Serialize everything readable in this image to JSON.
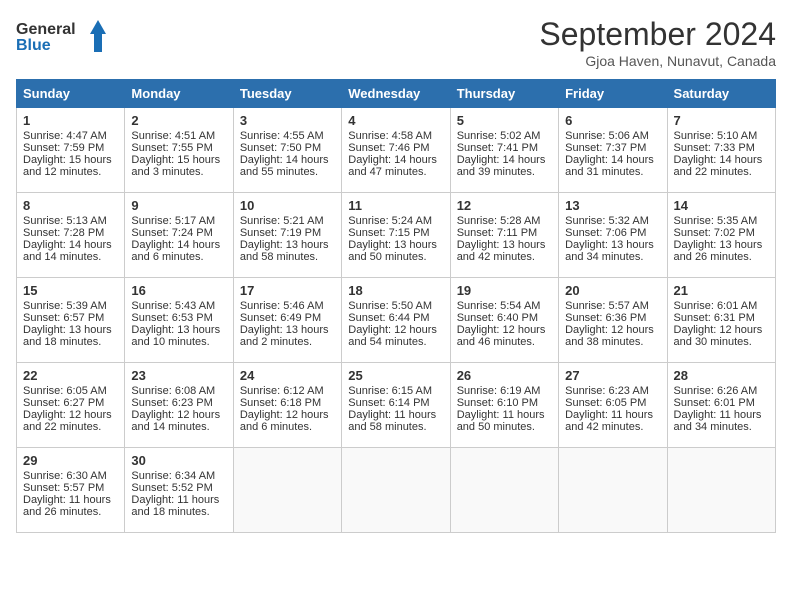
{
  "header": {
    "logo_line1": "General",
    "logo_line2": "Blue",
    "month_title": "September 2024",
    "location": "Gjoa Haven, Nunavut, Canada"
  },
  "days_of_week": [
    "Sunday",
    "Monday",
    "Tuesday",
    "Wednesday",
    "Thursday",
    "Friday",
    "Saturday"
  ],
  "weeks": [
    [
      {
        "day": "1",
        "lines": [
          "Sunrise: 4:47 AM",
          "Sunset: 7:59 PM",
          "Daylight: 15 hours",
          "and 12 minutes."
        ]
      },
      {
        "day": "2",
        "lines": [
          "Sunrise: 4:51 AM",
          "Sunset: 7:55 PM",
          "Daylight: 15 hours",
          "and 3 minutes."
        ]
      },
      {
        "day": "3",
        "lines": [
          "Sunrise: 4:55 AM",
          "Sunset: 7:50 PM",
          "Daylight: 14 hours",
          "and 55 minutes."
        ]
      },
      {
        "day": "4",
        "lines": [
          "Sunrise: 4:58 AM",
          "Sunset: 7:46 PM",
          "Daylight: 14 hours",
          "and 47 minutes."
        ]
      },
      {
        "day": "5",
        "lines": [
          "Sunrise: 5:02 AM",
          "Sunset: 7:41 PM",
          "Daylight: 14 hours",
          "and 39 minutes."
        ]
      },
      {
        "day": "6",
        "lines": [
          "Sunrise: 5:06 AM",
          "Sunset: 7:37 PM",
          "Daylight: 14 hours",
          "and 31 minutes."
        ]
      },
      {
        "day": "7",
        "lines": [
          "Sunrise: 5:10 AM",
          "Sunset: 7:33 PM",
          "Daylight: 14 hours",
          "and 22 minutes."
        ]
      }
    ],
    [
      {
        "day": "8",
        "lines": [
          "Sunrise: 5:13 AM",
          "Sunset: 7:28 PM",
          "Daylight: 14 hours",
          "and 14 minutes."
        ]
      },
      {
        "day": "9",
        "lines": [
          "Sunrise: 5:17 AM",
          "Sunset: 7:24 PM",
          "Daylight: 14 hours",
          "and 6 minutes."
        ]
      },
      {
        "day": "10",
        "lines": [
          "Sunrise: 5:21 AM",
          "Sunset: 7:19 PM",
          "Daylight: 13 hours",
          "and 58 minutes."
        ]
      },
      {
        "day": "11",
        "lines": [
          "Sunrise: 5:24 AM",
          "Sunset: 7:15 PM",
          "Daylight: 13 hours",
          "and 50 minutes."
        ]
      },
      {
        "day": "12",
        "lines": [
          "Sunrise: 5:28 AM",
          "Sunset: 7:11 PM",
          "Daylight: 13 hours",
          "and 42 minutes."
        ]
      },
      {
        "day": "13",
        "lines": [
          "Sunrise: 5:32 AM",
          "Sunset: 7:06 PM",
          "Daylight: 13 hours",
          "and 34 minutes."
        ]
      },
      {
        "day": "14",
        "lines": [
          "Sunrise: 5:35 AM",
          "Sunset: 7:02 PM",
          "Daylight: 13 hours",
          "and 26 minutes."
        ]
      }
    ],
    [
      {
        "day": "15",
        "lines": [
          "Sunrise: 5:39 AM",
          "Sunset: 6:57 PM",
          "Daylight: 13 hours",
          "and 18 minutes."
        ]
      },
      {
        "day": "16",
        "lines": [
          "Sunrise: 5:43 AM",
          "Sunset: 6:53 PM",
          "Daylight: 13 hours",
          "and 10 minutes."
        ]
      },
      {
        "day": "17",
        "lines": [
          "Sunrise: 5:46 AM",
          "Sunset: 6:49 PM",
          "Daylight: 13 hours",
          "and 2 minutes."
        ]
      },
      {
        "day": "18",
        "lines": [
          "Sunrise: 5:50 AM",
          "Sunset: 6:44 PM",
          "Daylight: 12 hours",
          "and 54 minutes."
        ]
      },
      {
        "day": "19",
        "lines": [
          "Sunrise: 5:54 AM",
          "Sunset: 6:40 PM",
          "Daylight: 12 hours",
          "and 46 minutes."
        ]
      },
      {
        "day": "20",
        "lines": [
          "Sunrise: 5:57 AM",
          "Sunset: 6:36 PM",
          "Daylight: 12 hours",
          "and 38 minutes."
        ]
      },
      {
        "day": "21",
        "lines": [
          "Sunrise: 6:01 AM",
          "Sunset: 6:31 PM",
          "Daylight: 12 hours",
          "and 30 minutes."
        ]
      }
    ],
    [
      {
        "day": "22",
        "lines": [
          "Sunrise: 6:05 AM",
          "Sunset: 6:27 PM",
          "Daylight: 12 hours",
          "and 22 minutes."
        ]
      },
      {
        "day": "23",
        "lines": [
          "Sunrise: 6:08 AM",
          "Sunset: 6:23 PM",
          "Daylight: 12 hours",
          "and 14 minutes."
        ]
      },
      {
        "day": "24",
        "lines": [
          "Sunrise: 6:12 AM",
          "Sunset: 6:18 PM",
          "Daylight: 12 hours",
          "and 6 minutes."
        ]
      },
      {
        "day": "25",
        "lines": [
          "Sunrise: 6:15 AM",
          "Sunset: 6:14 PM",
          "Daylight: 11 hours",
          "and 58 minutes."
        ]
      },
      {
        "day": "26",
        "lines": [
          "Sunrise: 6:19 AM",
          "Sunset: 6:10 PM",
          "Daylight: 11 hours",
          "and 50 minutes."
        ]
      },
      {
        "day": "27",
        "lines": [
          "Sunrise: 6:23 AM",
          "Sunset: 6:05 PM",
          "Daylight: 11 hours",
          "and 42 minutes."
        ]
      },
      {
        "day": "28",
        "lines": [
          "Sunrise: 6:26 AM",
          "Sunset: 6:01 PM",
          "Daylight: 11 hours",
          "and 34 minutes."
        ]
      }
    ],
    [
      {
        "day": "29",
        "lines": [
          "Sunrise: 6:30 AM",
          "Sunset: 5:57 PM",
          "Daylight: 11 hours",
          "and 26 minutes."
        ]
      },
      {
        "day": "30",
        "lines": [
          "Sunrise: 6:34 AM",
          "Sunset: 5:52 PM",
          "Daylight: 11 hours",
          "and 18 minutes."
        ]
      },
      null,
      null,
      null,
      null,
      null
    ]
  ]
}
